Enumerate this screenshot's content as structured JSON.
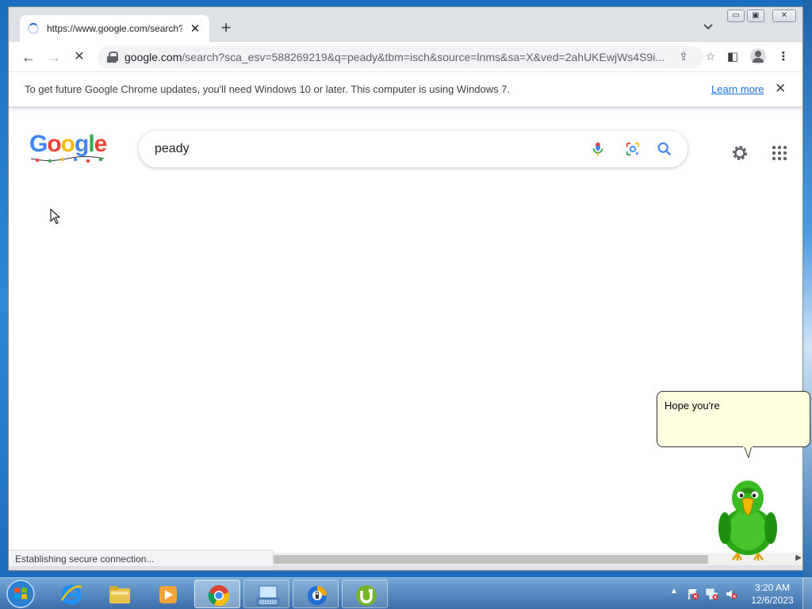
{
  "browser": {
    "tab_title": "https://www.google.com/search?",
    "tab_close": "✕",
    "new_tab": "+",
    "tab_list_icon": "chevron-down-icon",
    "window_controls": {
      "minimize": "▭",
      "maximize": "▣",
      "close": "✕"
    }
  },
  "toolbar": {
    "back": "←",
    "forward": "→",
    "reload": "✕",
    "url_host": "google.com",
    "url_path": "/search?sca_esv=588269219&q=peady&tbm=isch&source=lnms&sa=X&ved=2ahUKEwjWs4S9i...",
    "share": "⇪",
    "star": "☆",
    "side_panel": "◧",
    "menu": "⋮"
  },
  "infobar": {
    "message": "To get future Google Chrome updates, you'll need Windows 10 or later. This computer is using Windows 7.",
    "learn_more": "Learn more",
    "close": "✕"
  },
  "page": {
    "logo_letters": [
      "G",
      "o",
      "o",
      "g",
      "l",
      "e"
    ],
    "search_value": "peady"
  },
  "status": {
    "text": "Establishing secure connection..."
  },
  "assistant": {
    "bubble_text": "Hope you're"
  },
  "taskbar": {
    "apps": [
      "internet-explorer",
      "file-explorer",
      "media-player",
      "chrome",
      "on-screen-keyboard",
      "avast-secure-browser",
      "utorrent"
    ],
    "tray_arrow": "▲",
    "time": "3:20 AM",
    "date": "12/6/2023"
  },
  "colors": {
    "google_blue": "#4285f4",
    "google_red": "#ea4335",
    "google_yellow": "#fbbc05",
    "google_green": "#34a853",
    "link_blue": "#1a73e8"
  }
}
